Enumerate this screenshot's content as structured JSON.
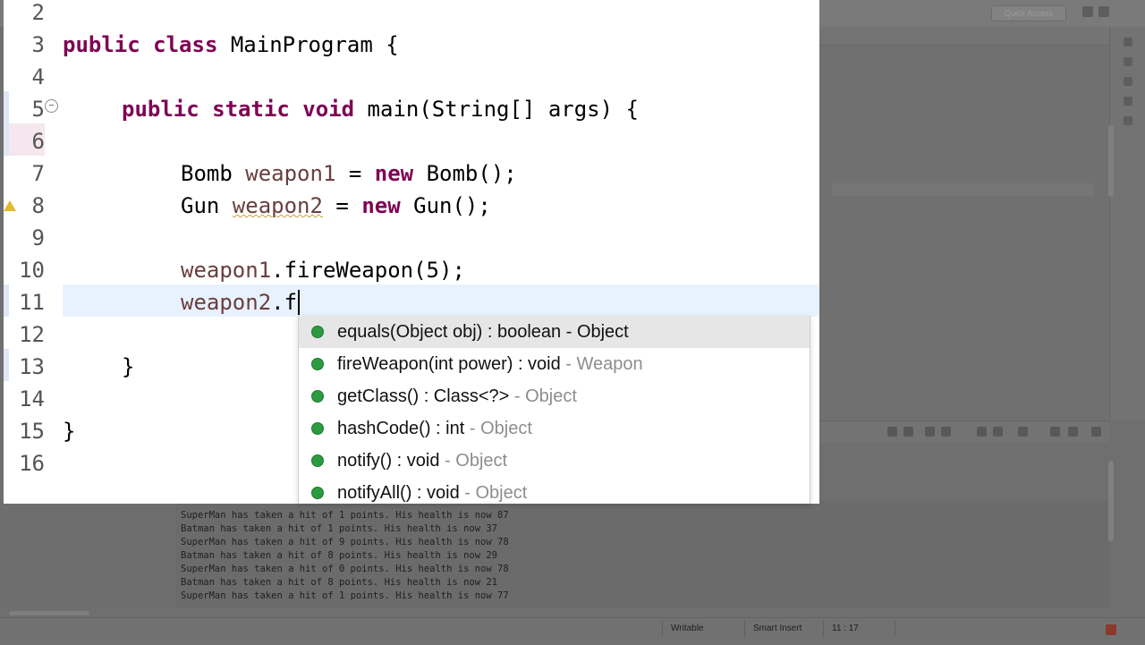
{
  "editor": {
    "lines": [
      {
        "num": "2"
      },
      {
        "num": "3"
      },
      {
        "num": "4"
      },
      {
        "num": "5"
      },
      {
        "num": "6"
      },
      {
        "num": "7"
      },
      {
        "num": "8"
      },
      {
        "num": "9"
      },
      {
        "num": "10"
      },
      {
        "num": "11"
      },
      {
        "num": "12"
      },
      {
        "num": "13"
      },
      {
        "num": "14"
      },
      {
        "num": "15"
      },
      {
        "num": "16"
      }
    ],
    "code": {
      "l3_kw": "public class",
      "l3_rest": " MainProgram {",
      "l5_kw": "public static void",
      "l5_rest": " main(String[] args) {",
      "l7_type": "Bomb ",
      "l7_var": "weapon1",
      "l7_eq": " = ",
      "l7_kw": "new",
      "l7_rest": " Bomb();",
      "l8_type": "Gun ",
      "l8_var": "weapon2",
      "l8_eq": " = ",
      "l8_kw": "new",
      "l8_rest": " Gun();",
      "l10_var": "weapon1",
      "l10_rest": ".fireWeapon(5);",
      "l11_var": "weapon2",
      "l11_rest": ".f",
      "l13": "}",
      "l15": "}"
    }
  },
  "autocomplete": {
    "items": [
      {
        "signature": "equals(Object obj) : boolean",
        "separator": " - ",
        "owner": "Object",
        "selected": true,
        "icon": "public-method-icon"
      },
      {
        "signature": "fireWeapon(int power) : void",
        "separator": " - ",
        "owner": "Weapon",
        "selected": false,
        "icon": "public-method-icon"
      },
      {
        "signature": "getClass() : Class<?>",
        "separator": " - ",
        "owner": "Object",
        "selected": false,
        "icon": "public-method-icon"
      },
      {
        "signature": "hashCode() : int",
        "separator": " - ",
        "owner": "Object",
        "selected": false,
        "icon": "public-method-icon"
      },
      {
        "signature": "notify() : void",
        "separator": " - ",
        "owner": "Object",
        "selected": false,
        "icon": "public-method-icon"
      },
      {
        "signature": "notifyAll() : void",
        "separator": " - ",
        "owner": "Object",
        "selected": false,
        "icon": "public-method-icon"
      }
    ]
  },
  "toolbar": {
    "quick_access": "Quick Access"
  },
  "console": {
    "lines": [
      "SuperMan has taken a hit of 1 points. His health is now 87",
      "Batman has taken a hit of 1 points. His health is now 37",
      "SuperMan has taken a hit of 9 points. His health is now 78",
      "Batman has taken a hit of 8 points. His health is now 29",
      "SuperMan has taken a hit of 0 points. His health is now 78",
      "Batman has taken a hit of 8 points. His health is now 21",
      "SuperMan has taken a hit of 1 points. His health is now 77"
    ]
  },
  "status": {
    "writable": "Writable",
    "insert_mode": "Smart Insert",
    "cursor_pos": "11 : 17"
  }
}
